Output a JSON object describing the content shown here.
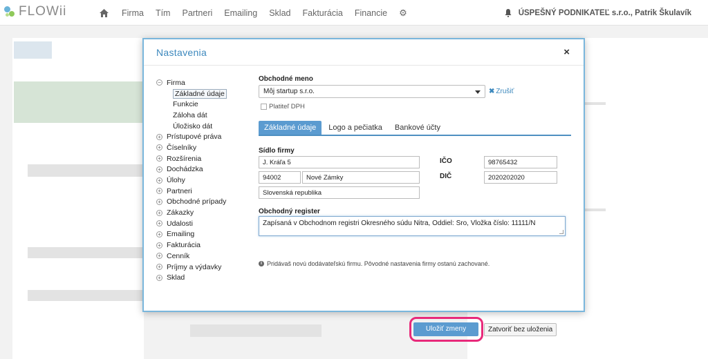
{
  "brand": {
    "name": "FLOWii"
  },
  "nav": {
    "home_icon": "home-icon",
    "items": [
      "Firma",
      "Tím",
      "Partneri",
      "Emailing",
      "Sklad",
      "Fakturácia",
      "Financie"
    ],
    "settings_icon": "gear-icon"
  },
  "account": {
    "company": "ÚSPEŠNÝ PODNIKATEĽ s.r.o., Patrik Škulavík"
  },
  "modal": {
    "title": "Nastavenia",
    "close": "×",
    "tree": [
      {
        "label": "Firma",
        "toggle": "−",
        "level": 0
      },
      {
        "label": "Základné údaje",
        "level": 1,
        "active": true
      },
      {
        "label": "Funkcie",
        "level": 1
      },
      {
        "label": "Záloha dát",
        "level": 1
      },
      {
        "label": "Úložisko dát",
        "level": 1
      },
      {
        "label": "Prístupové práva",
        "toggle": "+",
        "level": 0
      },
      {
        "label": "Číselníky",
        "toggle": "+",
        "level": 0
      },
      {
        "label": "Rozšírenia",
        "toggle": "+",
        "level": 0
      },
      {
        "label": "Dochádzka",
        "toggle": "+",
        "level": 0
      },
      {
        "label": "Úlohy",
        "toggle": "+",
        "level": 0
      },
      {
        "label": "Partneri",
        "toggle": "+",
        "level": 0
      },
      {
        "label": "Obchodné prípady",
        "toggle": "+",
        "level": 0
      },
      {
        "label": "Zákazky",
        "toggle": "+",
        "level": 0
      },
      {
        "label": "Udalosti",
        "toggle": "+",
        "level": 0
      },
      {
        "label": "Emailing",
        "toggle": "+",
        "level": 0
      },
      {
        "label": "Fakturácia",
        "toggle": "+",
        "level": 0
      },
      {
        "label": "Cenník",
        "toggle": "+",
        "level": 0
      },
      {
        "label": "Príjmy a výdavky",
        "toggle": "+",
        "level": 0
      },
      {
        "label": "Sklad",
        "toggle": "+",
        "level": 0
      }
    ],
    "form": {
      "business_name_label": "Obchodné meno",
      "business_name_value": "Môj startup s.r.o.",
      "cancel_link": "Zrušiť",
      "vat_payer_label": "Platiteľ DPH",
      "tabs": [
        "Základné údaje",
        "Logo a pečiatka",
        "Bankové účty"
      ],
      "address_label": "Sídlo firmy",
      "street": "J. Kráľa 5",
      "zip": "94002",
      "city": "Nové Zámky",
      "country": "Slovenská republika",
      "ico_label": "IČO",
      "ico_value": "98765432",
      "dic_label": "DIČ",
      "dic_value": "2020202020",
      "register_label": "Obchodný register",
      "register_value": "Zapísaná v Obchodnom registri Okresného súdu Nitra, Oddiel: Sro, Vložka číslo: 11111/N",
      "info_text": "Pridávaš novú dodávateľskú firmu. Pôvodné nastavenia firmy ostanú zachované.",
      "save_button": "Uložiť zmeny",
      "close_button": "Zatvoriť bez uloženia"
    }
  }
}
